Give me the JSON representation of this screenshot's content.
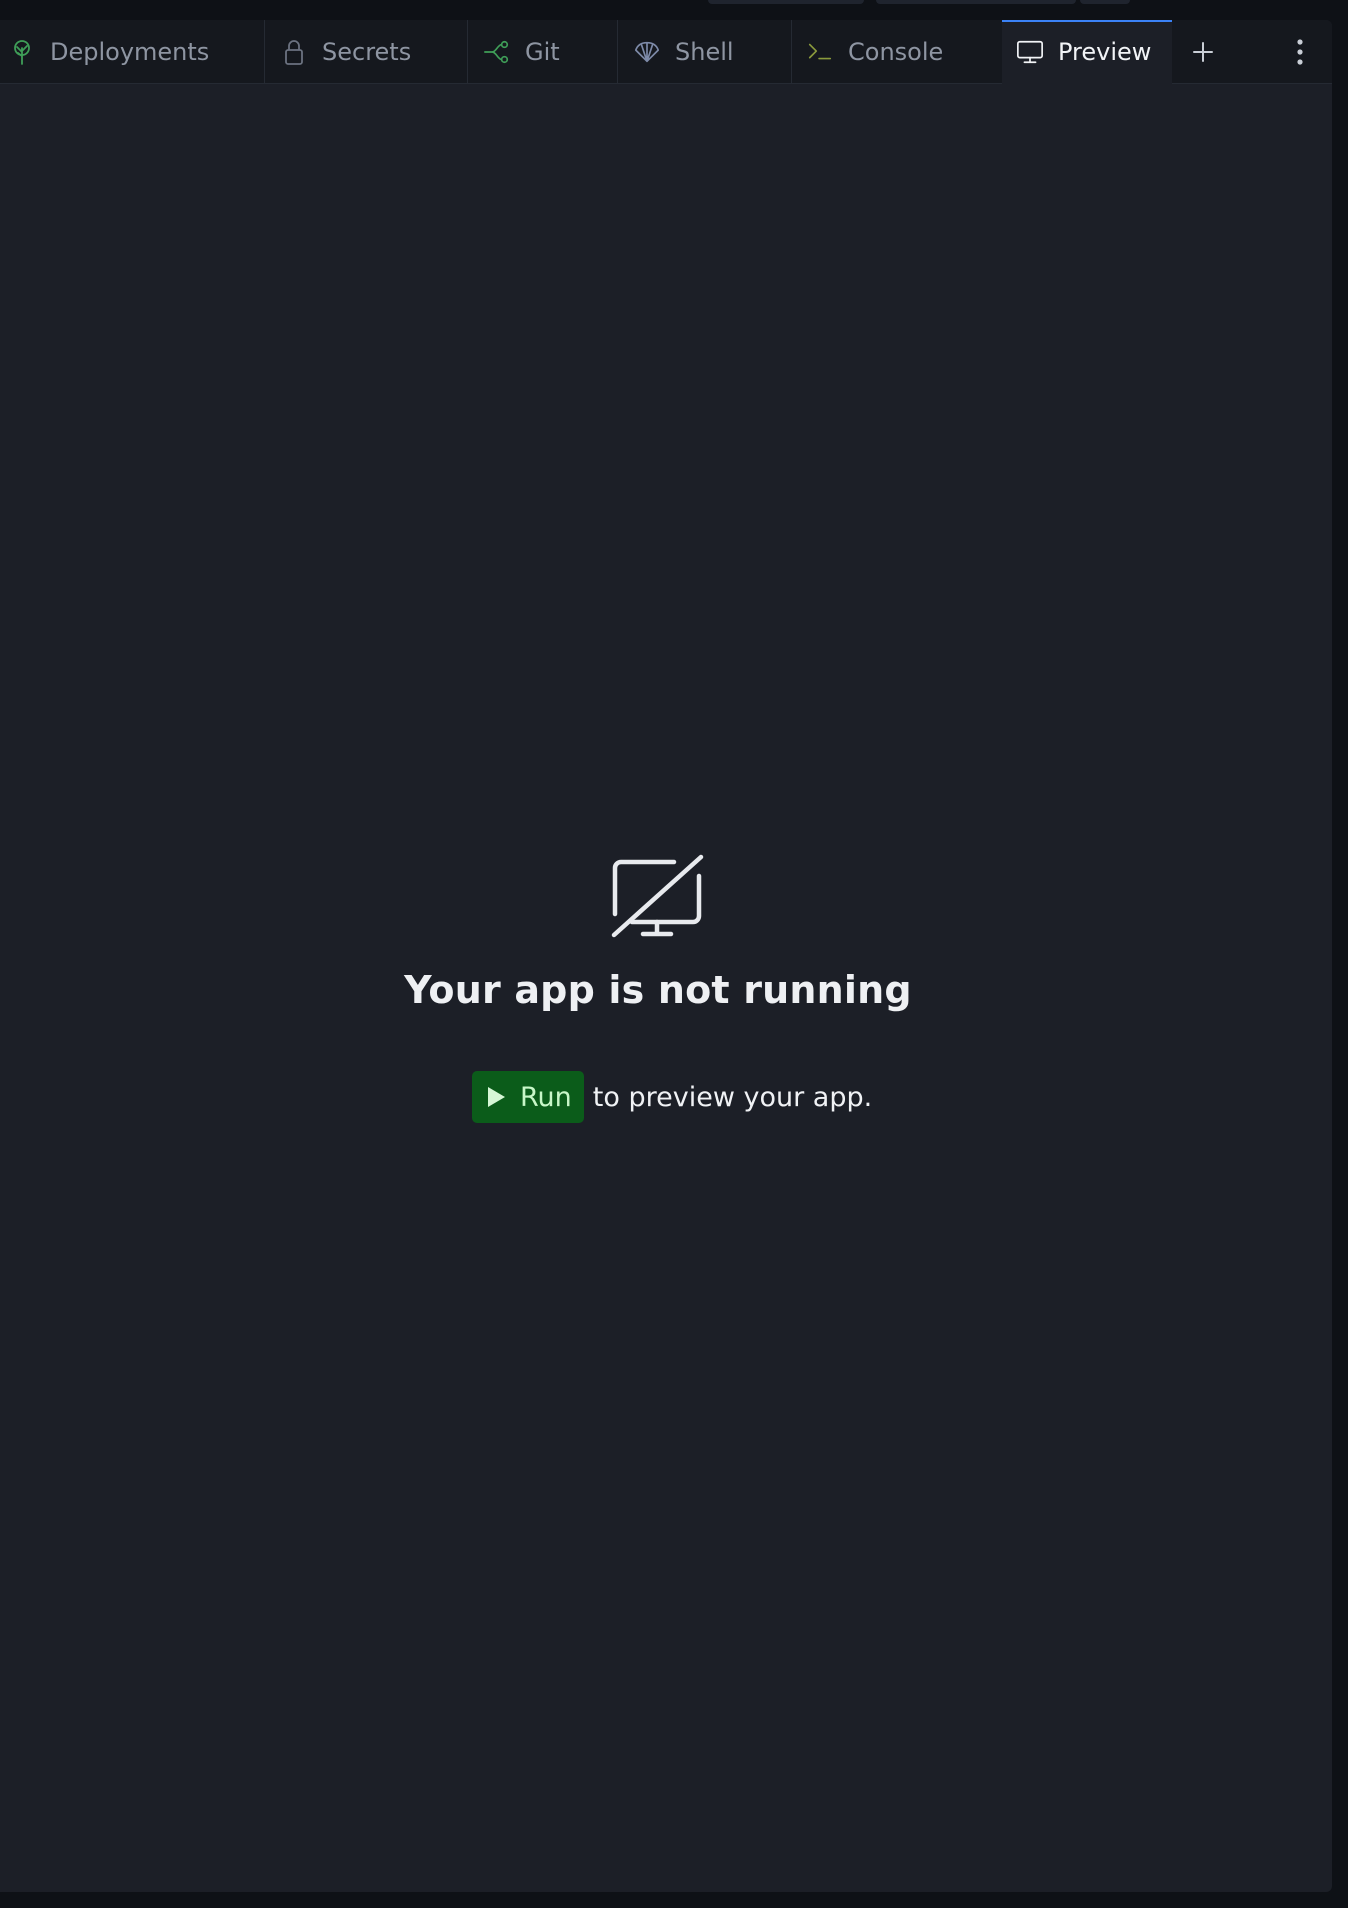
{
  "tabs": [
    {
      "id": "deployments",
      "label": "Deployments",
      "icon": "deployments-icon",
      "active": false
    },
    {
      "id": "secrets",
      "label": "Secrets",
      "icon": "lock-icon",
      "active": false
    },
    {
      "id": "git",
      "label": "Git",
      "icon": "git-icon",
      "active": false
    },
    {
      "id": "shell",
      "label": "Shell",
      "icon": "shell-icon",
      "active": false
    },
    {
      "id": "console",
      "label": "Console",
      "icon": "terminal-icon",
      "active": false
    },
    {
      "id": "preview",
      "label": "Preview",
      "icon": "monitor-icon",
      "active": true
    }
  ],
  "tabbar": {
    "add_icon": "plus-icon",
    "menu_icon": "vertical-ellipsis-icon"
  },
  "preview": {
    "empty_icon": "monitor-off-icon",
    "title": "Your app is not running",
    "run_button_label": "Run",
    "run_suffix": "to preview your app."
  },
  "colors": {
    "active_tab_indicator": "#3b82f6",
    "run_button_bg": "#0b5c1a",
    "run_button_text": "#c8f7c8",
    "panel_bg": "#1c1f27",
    "tabbar_bg": "#15181e"
  }
}
